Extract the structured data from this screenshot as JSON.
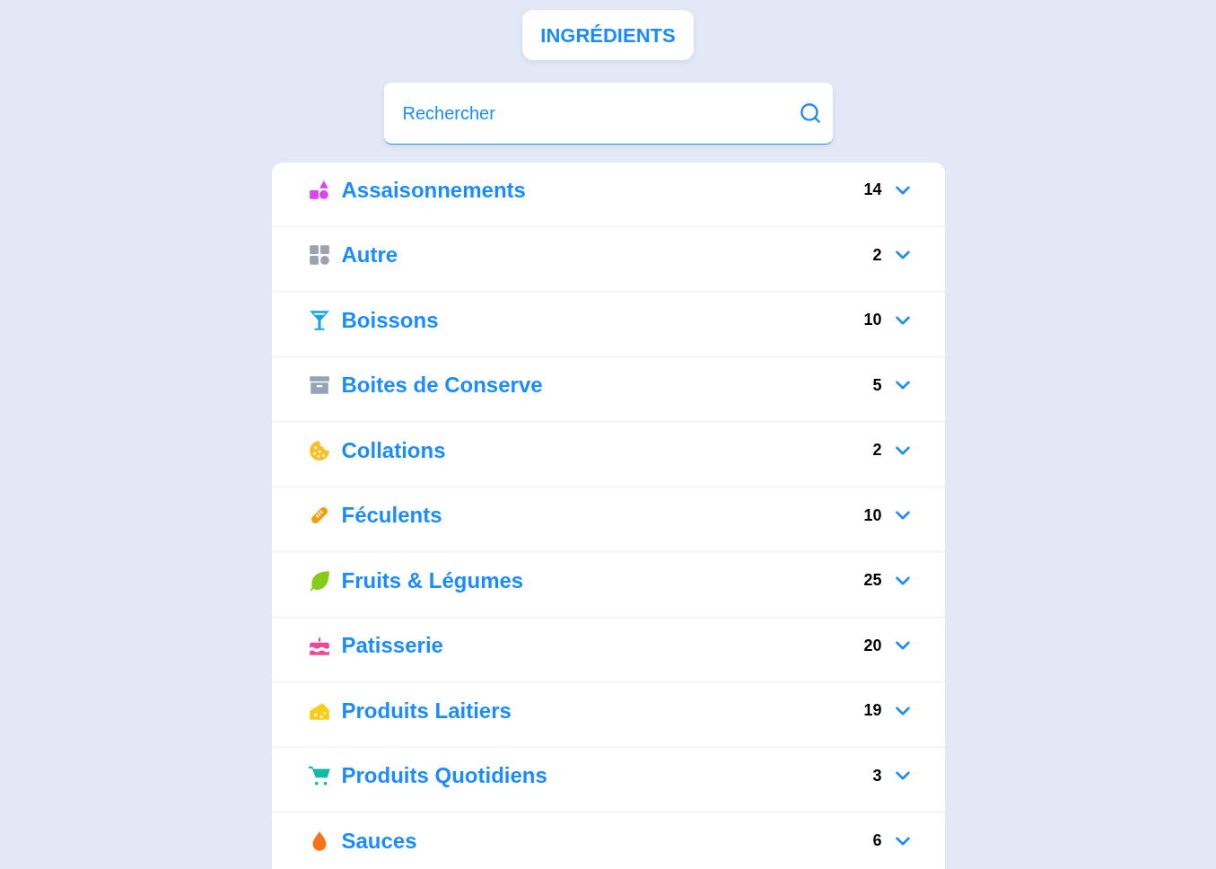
{
  "header": {
    "title": "INGRÉDIENTS"
  },
  "search": {
    "placeholder": "Rechercher"
  },
  "categories": [
    {
      "name": "Assaisonnements",
      "count": "14",
      "color": "#d946ef",
      "expanded": false
    },
    {
      "name": "Autre",
      "count": "2",
      "color": "#9ca3af",
      "expanded": false
    },
    {
      "name": "Boissons",
      "count": "10",
      "color": "#0ea5e9",
      "expanded": false
    },
    {
      "name": "Boites de Conserve",
      "count": "5",
      "color": "#94a3b8",
      "expanded": false
    },
    {
      "name": "Collations",
      "count": "2",
      "color": "#fbbf24",
      "expanded": false
    },
    {
      "name": "Féculents",
      "count": "10",
      "color": "#f59e0b",
      "expanded": false
    },
    {
      "name": "Fruits & Légumes",
      "count": "25",
      "color": "#84cc16",
      "expanded": false
    },
    {
      "name": "Patisserie",
      "count": "20",
      "color": "#ec4899",
      "expanded": false
    },
    {
      "name": "Produits Laitiers",
      "count": "19",
      "color": "#facc15",
      "expanded": false
    },
    {
      "name": "Produits Quotidiens",
      "count": "3",
      "color": "#14b8a6",
      "expanded": false
    },
    {
      "name": "Sauces",
      "count": "6",
      "color": "#f97316",
      "expanded": false
    }
  ]
}
